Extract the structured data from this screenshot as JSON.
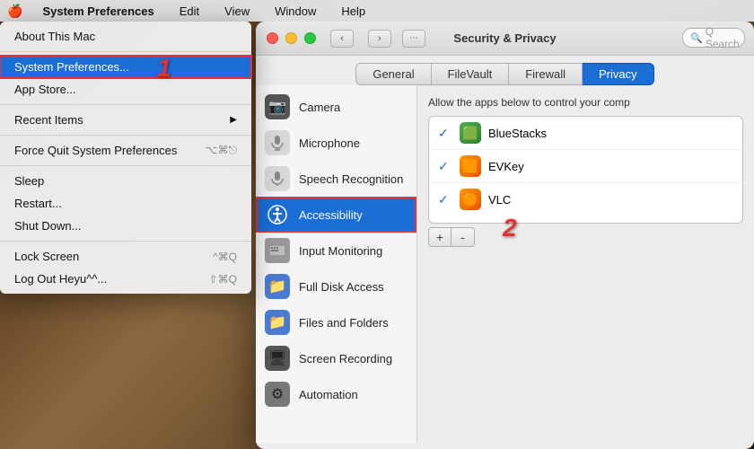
{
  "menubar": {
    "apple": "🍎",
    "app_name": "System Preferences",
    "menus": [
      "Edit",
      "View",
      "Window",
      "Help"
    ]
  },
  "dropdown": {
    "items": [
      {
        "label": "About This Mac",
        "shortcut": "",
        "arrow": false,
        "type": "item"
      },
      {
        "type": "divider"
      },
      {
        "label": "System Preferences...",
        "shortcut": "",
        "arrow": false,
        "type": "item",
        "highlighted": true
      },
      {
        "label": "App Store...",
        "shortcut": "",
        "arrow": false,
        "type": "item"
      },
      {
        "type": "divider"
      },
      {
        "label": "Recent Items",
        "shortcut": "",
        "arrow": true,
        "type": "item"
      },
      {
        "type": "divider"
      },
      {
        "label": "Force Quit System Preferences",
        "shortcut": "⌥⌘⎋",
        "arrow": false,
        "type": "item"
      },
      {
        "type": "divider"
      },
      {
        "label": "Sleep",
        "shortcut": "",
        "arrow": false,
        "type": "item"
      },
      {
        "label": "Restart...",
        "shortcut": "",
        "arrow": false,
        "type": "item"
      },
      {
        "label": "Shut Down...",
        "shortcut": "",
        "arrow": false,
        "type": "item"
      },
      {
        "type": "divider"
      },
      {
        "label": "Lock Screen",
        "shortcut": "^⌘Q",
        "arrow": false,
        "type": "item"
      },
      {
        "label": "Log Out Heyu^^...",
        "shortcut": "⇧⌘Q",
        "arrow": false,
        "type": "item"
      }
    ]
  },
  "window": {
    "title": "Security & Privacy",
    "search_placeholder": "Q Search",
    "tabs": [
      "General",
      "FileVault",
      "Firewall",
      "Privacy"
    ],
    "active_tab": "Privacy",
    "nav": {
      "back": "‹",
      "forward": "›",
      "grid": "⋯"
    }
  },
  "sidebar": {
    "items": [
      {
        "label": "Camera",
        "icon": "📷",
        "active": false
      },
      {
        "label": "Microphone",
        "icon": "🎤",
        "active": false
      },
      {
        "label": "Speech Recognition",
        "icon": "🎤",
        "active": false
      },
      {
        "label": "Accessibility",
        "icon": "♿",
        "active": true
      },
      {
        "label": "Input Monitoring",
        "icon": "⌨",
        "active": false
      },
      {
        "label": "Full Disk Access",
        "icon": "📁",
        "active": false
      },
      {
        "label": "Files and Folders",
        "icon": "📁",
        "active": false
      },
      {
        "label": "Screen Recording",
        "icon": "🖥",
        "active": false
      },
      {
        "label": "Automation",
        "icon": "⚙",
        "active": false
      }
    ]
  },
  "right_panel": {
    "allow_label": "Allow the apps below to control your comp",
    "apps": [
      {
        "name": "BlueStacks",
        "checked": true,
        "icon": "🟩"
      },
      {
        "name": "EVKey",
        "checked": true,
        "icon": "🟧"
      },
      {
        "name": "VLC",
        "checked": true,
        "icon": "🟠"
      }
    ],
    "add_btn": "+",
    "remove_btn": "-"
  },
  "annotations": {
    "step1": "1",
    "step2": "2"
  }
}
